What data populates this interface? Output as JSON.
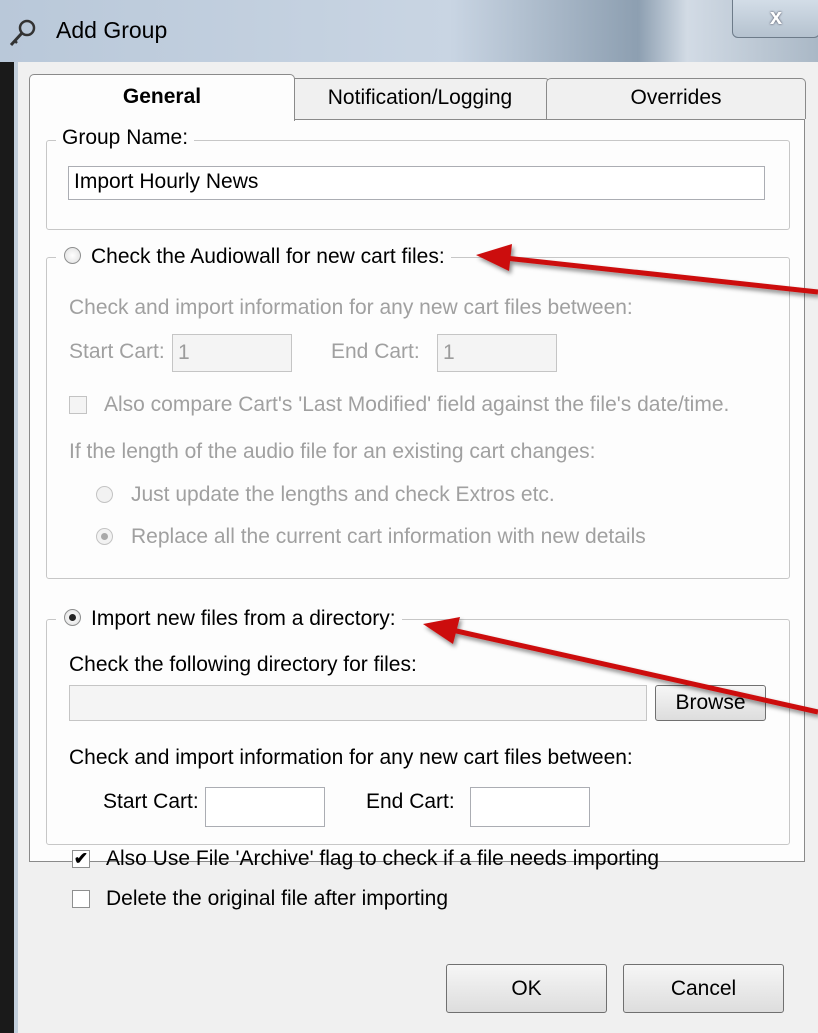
{
  "window": {
    "title": "Add Group",
    "title_icon": "key-icon",
    "close_label": "x"
  },
  "tabs": [
    {
      "label": "General",
      "active": true
    },
    {
      "label": "Notification/Logging",
      "active": false
    },
    {
      "label": "Overrides",
      "active": false
    }
  ],
  "group_name": {
    "legend": "Group Name:",
    "value": "Import Hourly News"
  },
  "audiowall": {
    "radio_label": "Check the Audiowall for new cart files:",
    "selected": false,
    "range_text": "Check and import information for any new cart files between:",
    "start_label": "Start Cart:",
    "start_value": "1",
    "end_label": "End Cart:",
    "end_value": "1",
    "compare_label": "Also compare Cart's 'Last Modified' field against the file's date/time.",
    "compare_checked": false,
    "length_text": "If the length of the audio file for an existing cart changes:",
    "option_update": "Just update the lengths and check Extros etc.",
    "option_replace": "Replace all the current cart information with new details",
    "replace_selected": true
  },
  "directory": {
    "radio_label": "Import new files from a directory:",
    "selected": true,
    "check_text": "Check the following directory for files:",
    "path_value": "",
    "browse_label": "Browse",
    "range_text": "Check and import information for any new cart files between:",
    "start_label": "Start Cart:",
    "start_value": "",
    "end_label": "End Cart:",
    "end_value": "",
    "archive_label": "Also Use File 'Archive' flag to check if a file needs importing",
    "archive_checked": true,
    "archive_mark": "✔",
    "delete_label": "Delete the original file after importing",
    "delete_checked": false
  },
  "footer": {
    "ok_label": "OK",
    "cancel_label": "Cancel"
  },
  "annotation_color": "#cc1111"
}
